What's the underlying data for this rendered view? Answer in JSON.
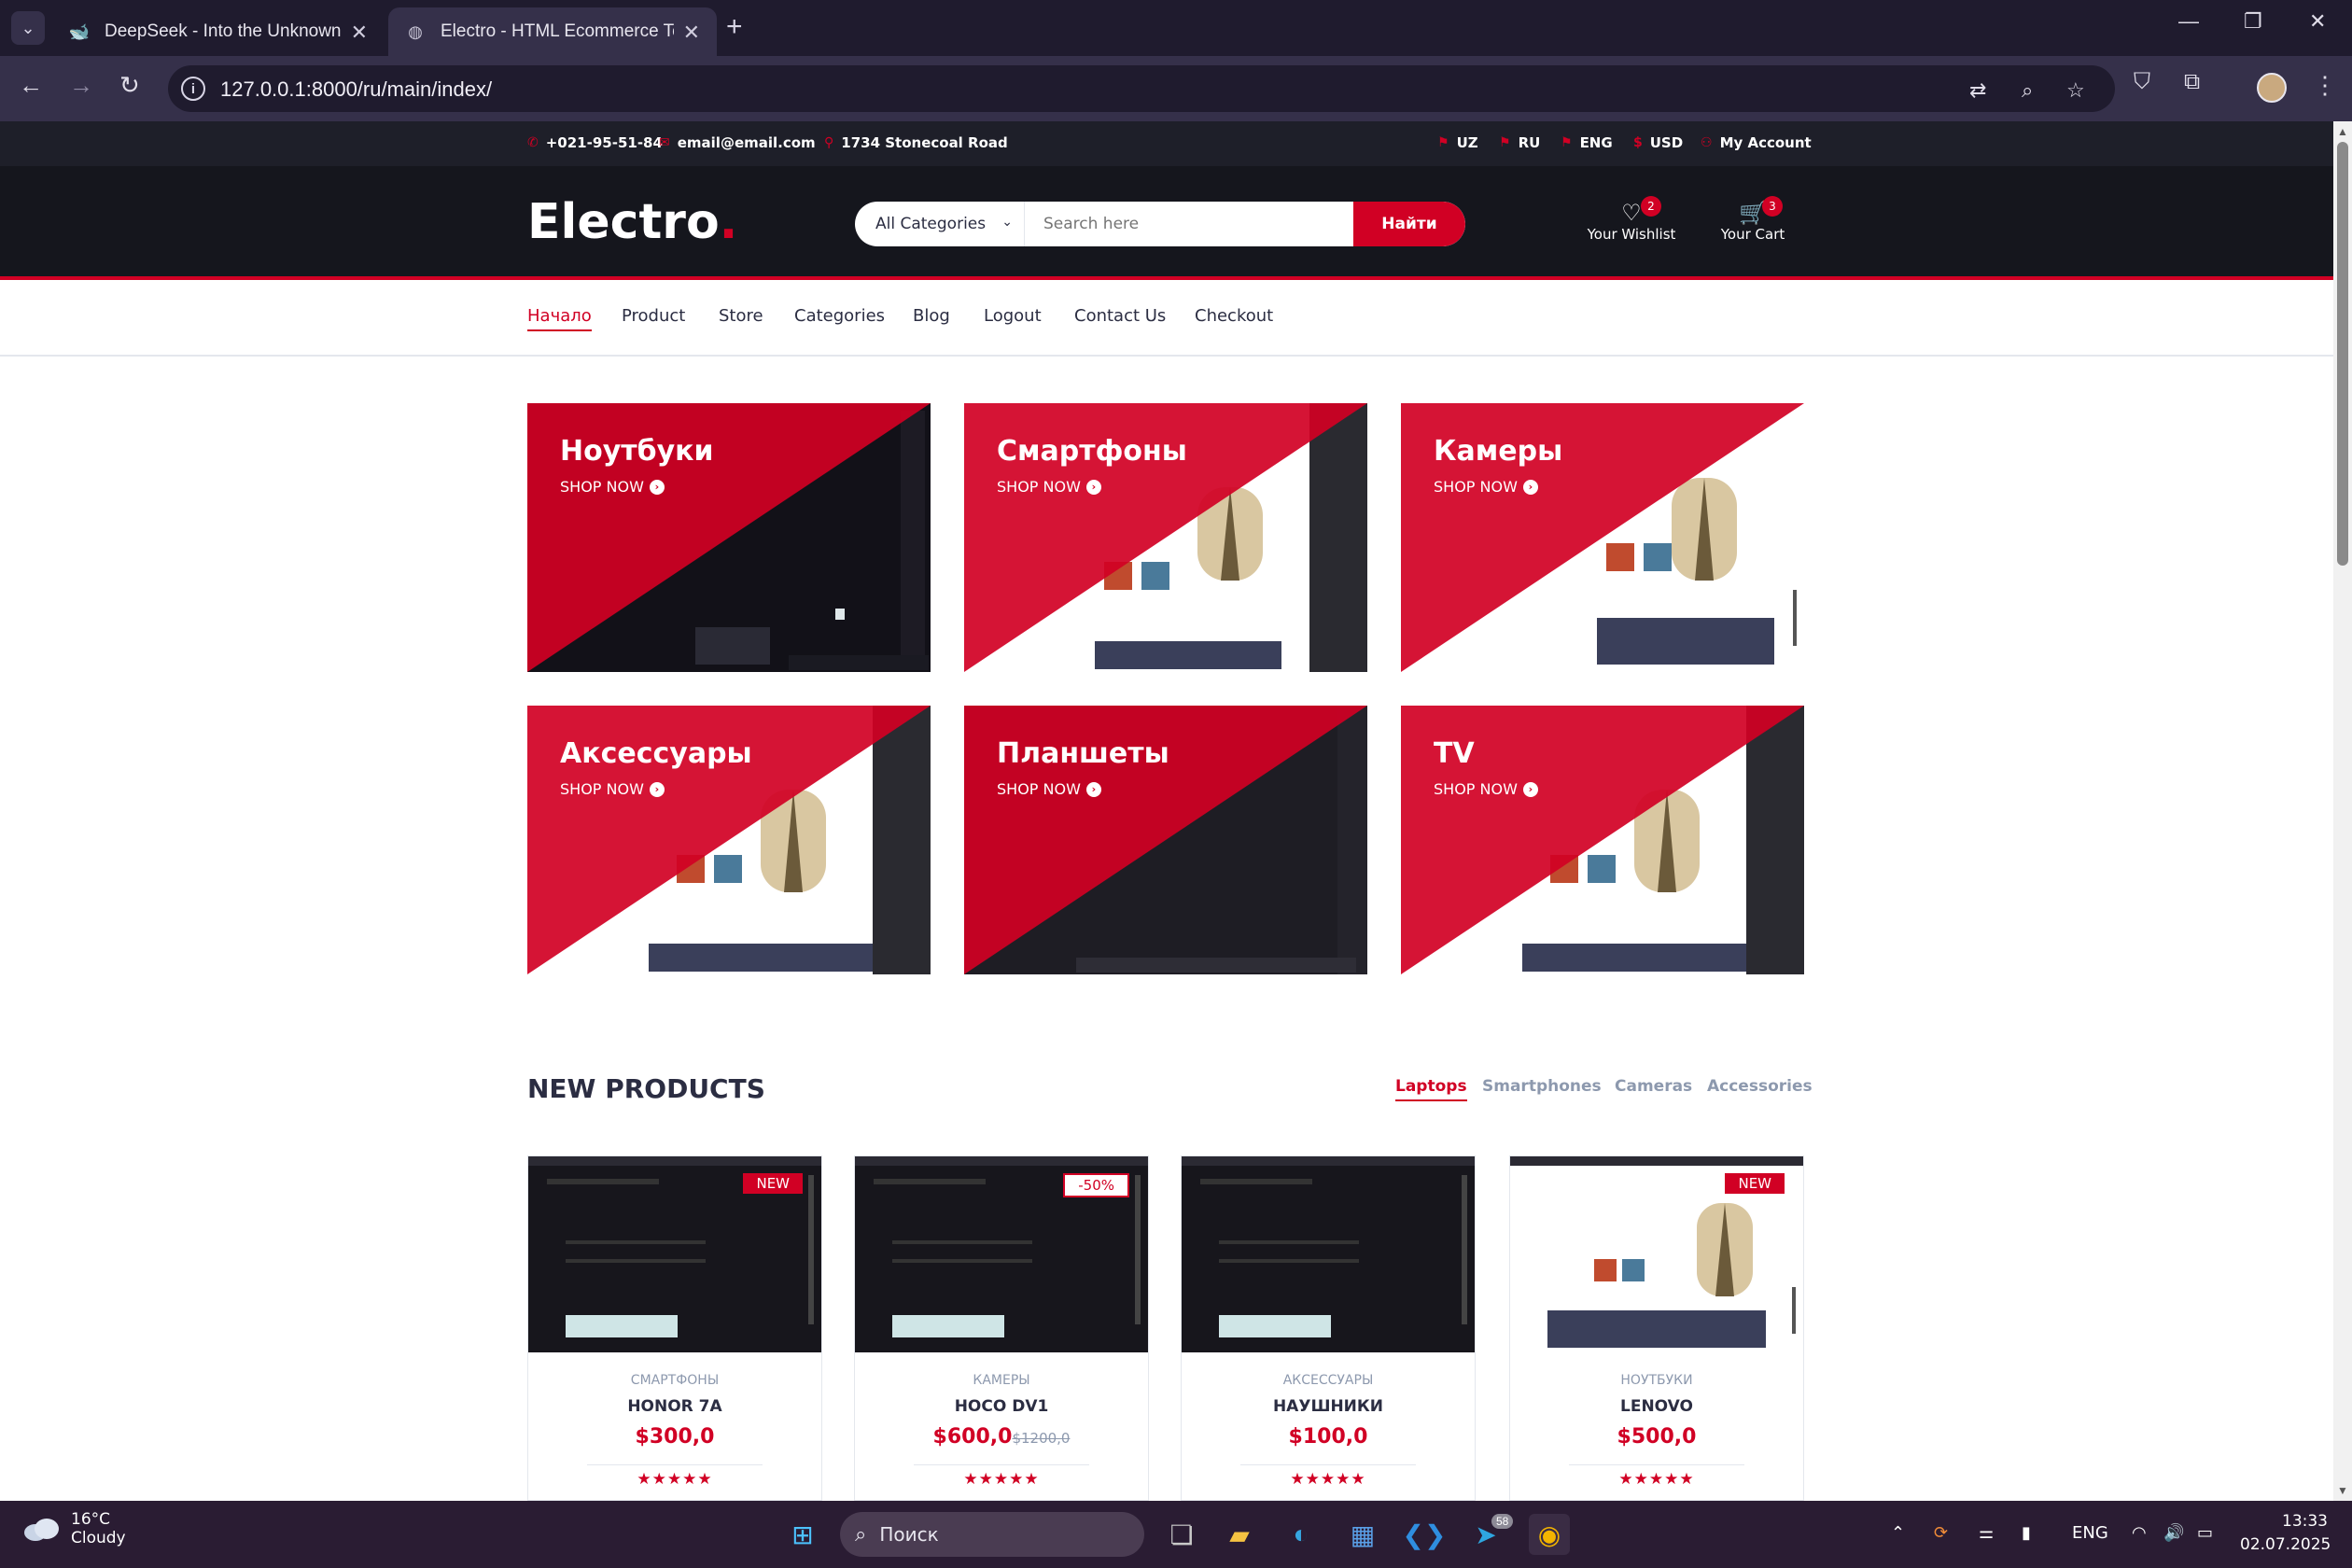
{
  "browser": {
    "tabs": [
      {
        "title": "DeepSeek - Into the Unknown",
        "active": false
      },
      {
        "title": "Electro - HTML Ecommerce Template",
        "active": true
      }
    ],
    "url": "127.0.0.1:8000/ru/main/index/"
  },
  "top_header": {
    "phone": "+021-95-51-84",
    "email": "email@email.com",
    "address": "1734 Stonecoal Road",
    "languages": [
      "UZ",
      "RU",
      "ENG"
    ],
    "currency": "USD",
    "account": "My Account"
  },
  "header": {
    "logo": "Electro",
    "logo_dot": ".",
    "search": {
      "category": "All Categories",
      "placeholder": "Search here",
      "button": "Найти"
    },
    "wishlist": {
      "label": "Your Wishlist",
      "count": "2"
    },
    "cart": {
      "label": "Your Cart",
      "count": "3"
    }
  },
  "nav": [
    "Начало",
    "Product",
    "Store",
    "Categories",
    "Blog",
    "Logout",
    "Contact Us",
    "Checkout"
  ],
  "nav_active": "Начало",
  "shop_tiles": [
    {
      "name": "Ноутбуки",
      "cta": "SHOP NOW"
    },
    {
      "name": "Смартфоны",
      "cta": "SHOP NOW"
    },
    {
      "name": "Камеры",
      "cta": "SHOP NOW"
    },
    {
      "name": "Аксессуары",
      "cta": "SHOP NOW"
    },
    {
      "name": "Планшеты",
      "cta": "SHOP NOW"
    },
    {
      "name": "TV",
      "cta": "SHOP NOW"
    }
  ],
  "new_products": {
    "title": "NEW PRODUCTS",
    "tabs": [
      "Laptops",
      "Smartphones",
      "Cameras",
      "Accessories"
    ],
    "active_tab": "Laptops",
    "items": [
      {
        "label": "NEW",
        "category": "СМАРТФОНЫ",
        "name": "HONOR 7A",
        "price": "$300,0",
        "old_price": "",
        "rating": 5
      },
      {
        "label": "-50%",
        "category": "КАМЕРЫ",
        "name": "HOCO DV1",
        "price": "$600,0",
        "old_price": "$1200,0",
        "rating": 5
      },
      {
        "label": "",
        "category": "АКСЕССУАРЫ",
        "name": "НАУШНИКИ",
        "price": "$100,0",
        "old_price": "",
        "rating": 5
      },
      {
        "label": "NEW",
        "category": "НОУТБУКИ",
        "name": "LENOVO",
        "price": "$500,0",
        "old_price": "",
        "rating": 5
      }
    ]
  },
  "taskbar": {
    "weather": {
      "temp": "16°C",
      "condition": "Cloudy"
    },
    "search_placeholder": "Поиск",
    "telegram_badge": "58",
    "language": "ENG",
    "time": "13:33",
    "date": "02.07.2025"
  },
  "colors": {
    "accent": "#d10024",
    "header_dark": "#15161d",
    "top_bar": "#1e1f29",
    "text": "#2b2d42",
    "muted": "#8d99ae"
  }
}
